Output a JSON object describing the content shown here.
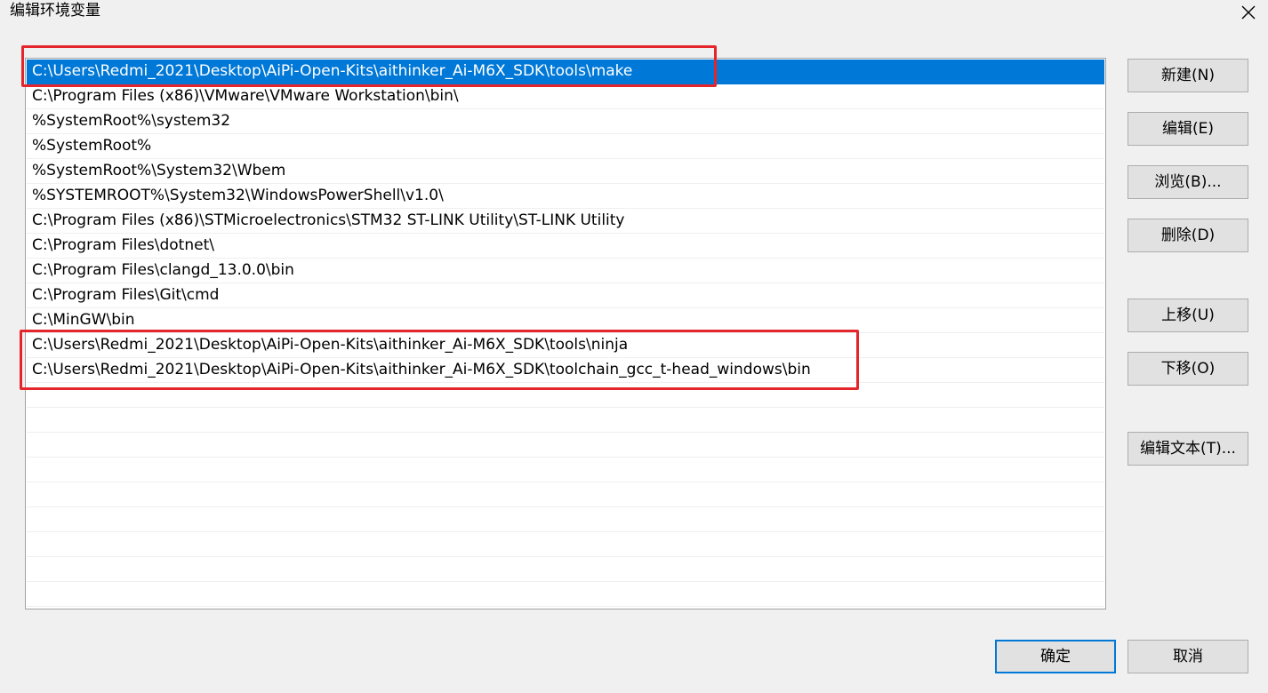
{
  "window": {
    "title": "编辑环境变量"
  },
  "paths": [
    "C:\\Users\\Redmi_2021\\Desktop\\AiPi-Open-Kits\\aithinker_Ai-M6X_SDK\\tools\\make",
    "C:\\Program Files (x86)\\VMware\\VMware Workstation\\bin\\",
    "%SystemRoot%\\system32",
    "%SystemRoot%",
    "%SystemRoot%\\System32\\Wbem",
    "%SYSTEMROOT%\\System32\\WindowsPowerShell\\v1.0\\",
    "C:\\Program Files (x86)\\STMicroelectronics\\STM32 ST-LINK Utility\\ST-LINK Utility",
    "C:\\Program Files\\dotnet\\",
    "C:\\Program Files\\clangd_13.0.0\\bin",
    "C:\\Program Files\\Git\\cmd",
    "C:\\MinGW\\bin",
    "C:\\Users\\Redmi_2021\\Desktop\\AiPi-Open-Kits\\aithinker_Ai-M6X_SDK\\tools\\ninja",
    "C:\\Users\\Redmi_2021\\Desktop\\AiPi-Open-Kits\\aithinker_Ai-M6X_SDK\\toolchain_gcc_t-head_windows\\bin"
  ],
  "selected_index": 0,
  "empty_rows": 9,
  "buttons": {
    "new": "新建(N)",
    "edit": "编辑(E)",
    "browse": "浏览(B)...",
    "delete": "删除(D)",
    "move_up": "上移(U)",
    "move_down": "下移(O)",
    "edit_text": "编辑文本(T)...",
    "ok": "确定",
    "cancel": "取消"
  },
  "colors": {
    "selection": "#0078d7",
    "highlight_box": "#e4262c"
  }
}
